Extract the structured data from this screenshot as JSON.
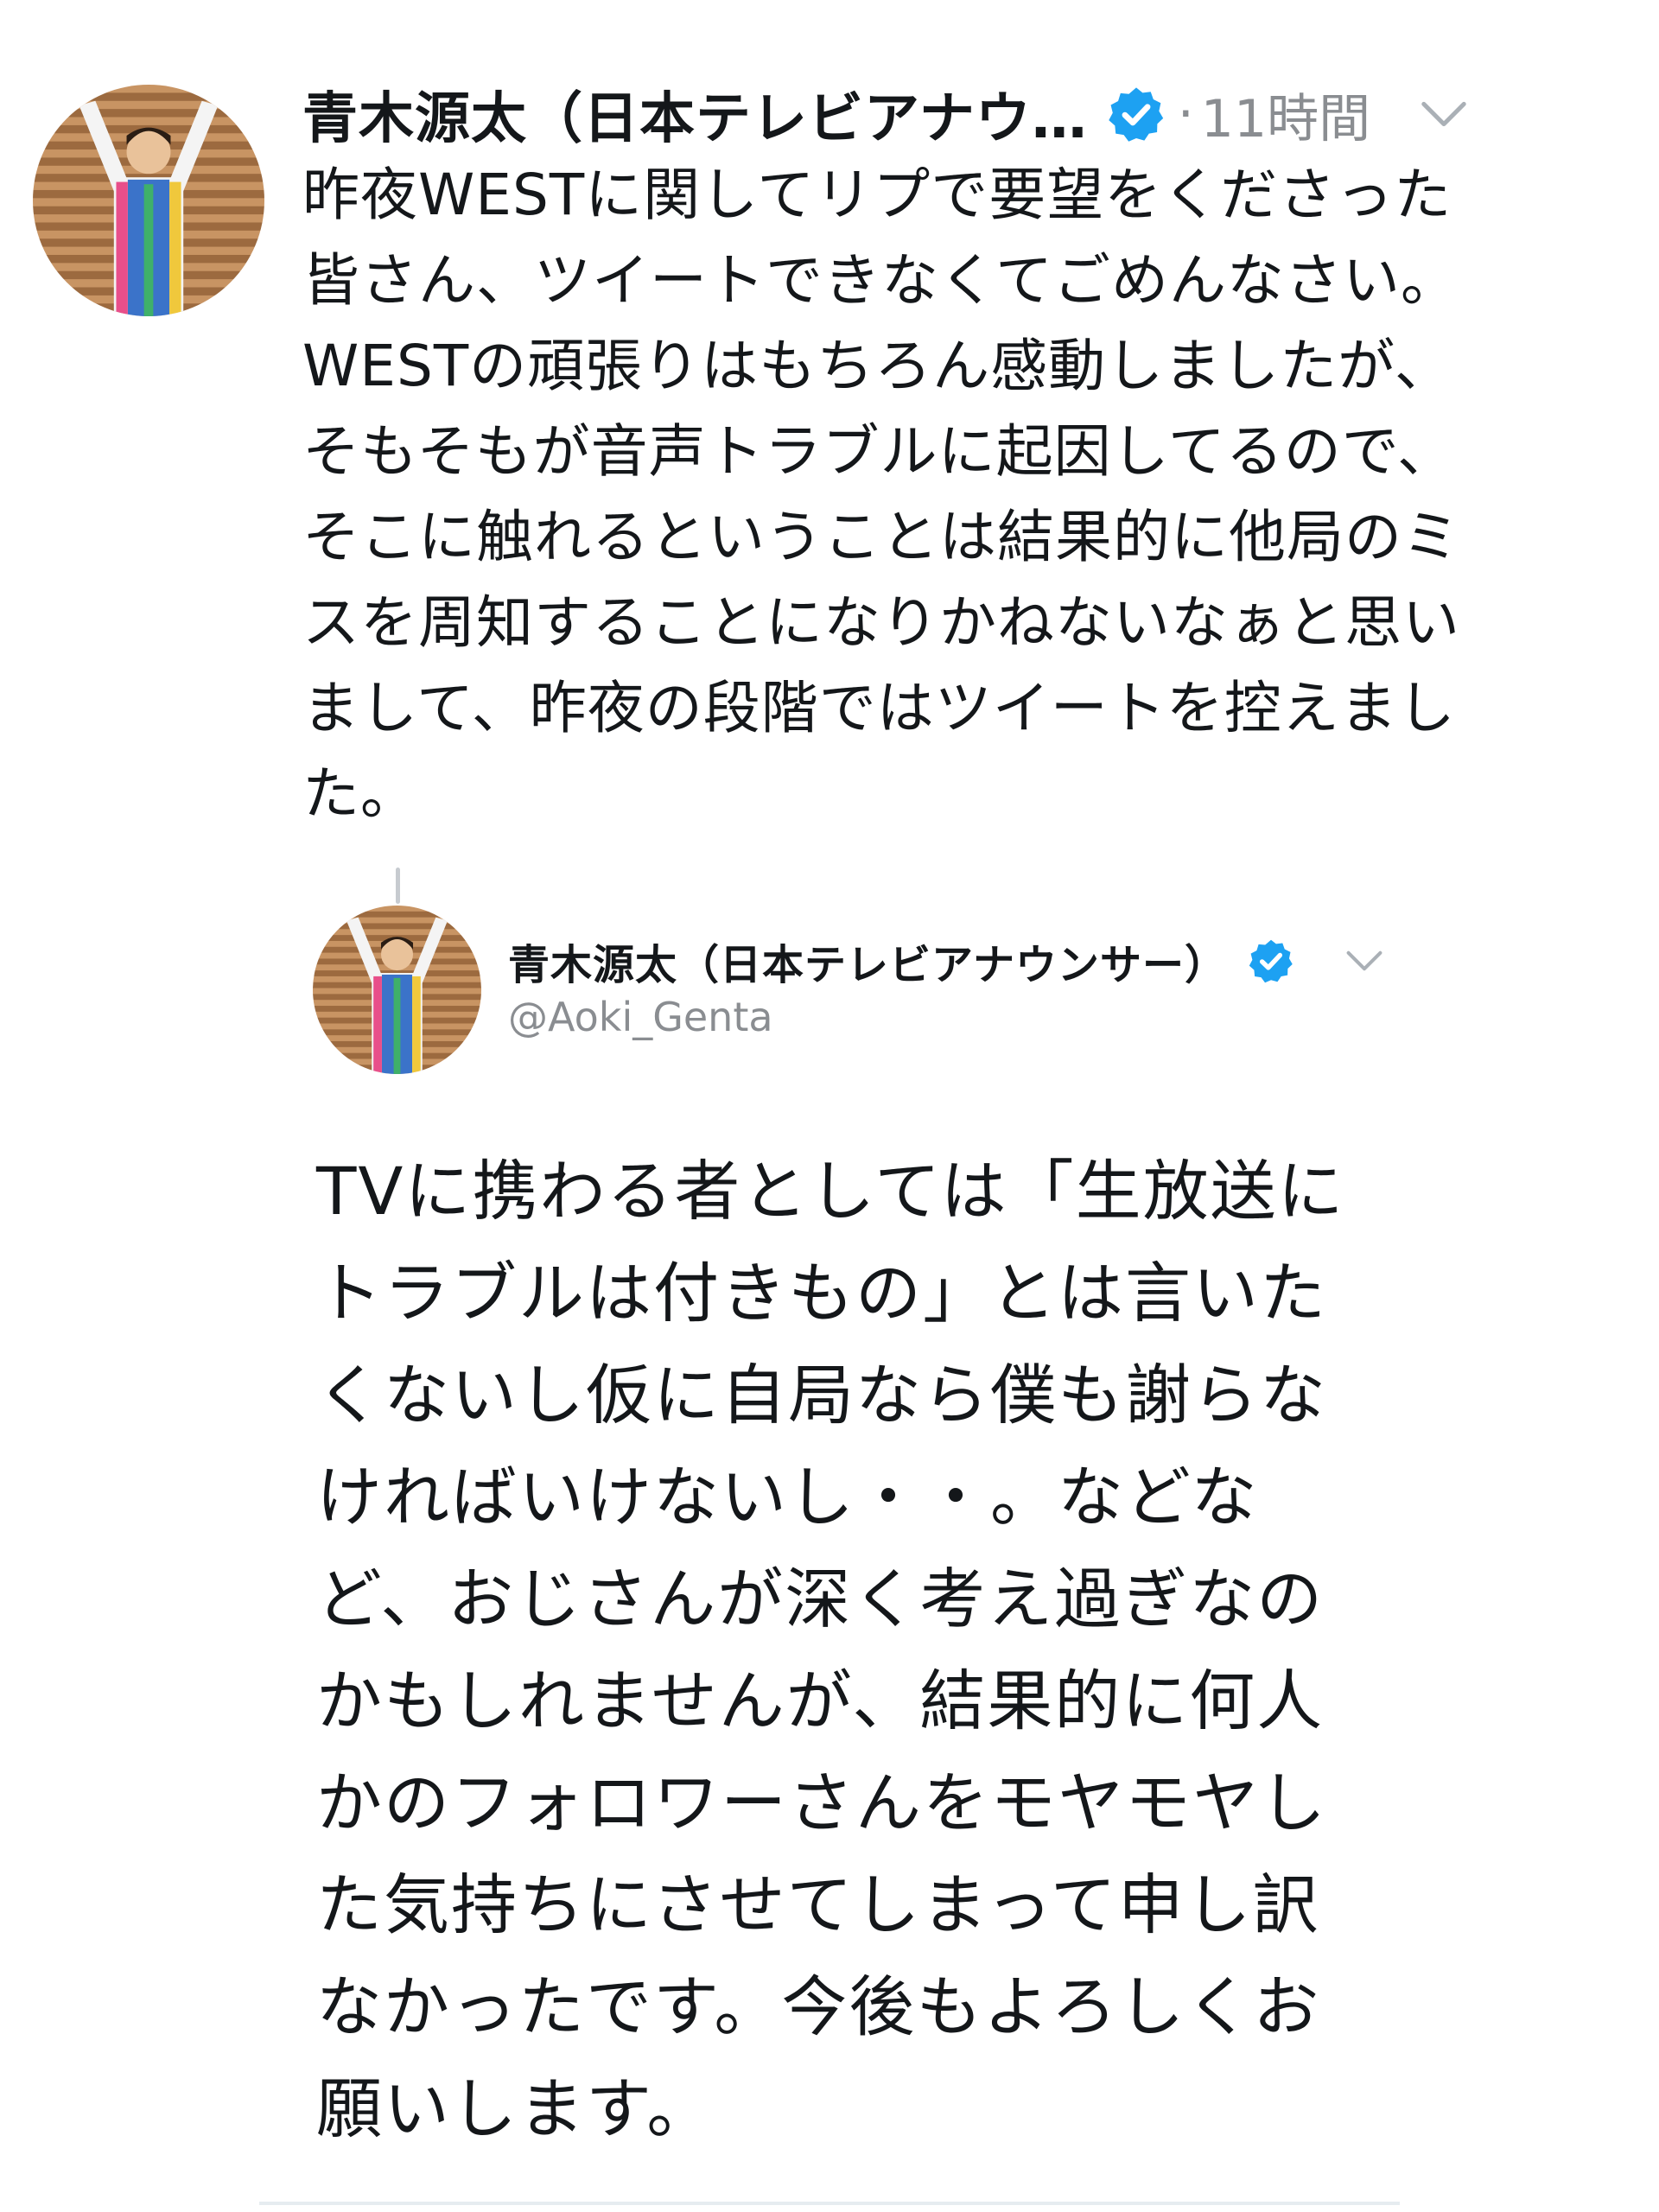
{
  "tweet": {
    "author_name": "青木源太（日本テレビアナウ…",
    "verified_icon": "verified-badge-icon",
    "separator": "·",
    "timestamp": "11時間",
    "menu_icon": "chevron-down-icon",
    "text_lines": [
      "昨夜WESTに関してリプで要望をくださった",
      "皆さん、ツイートできなくてごめんなさい。",
      "WESTの頑張りはもちろん感動しましたが、",
      "そもそもが音声トラブルに起因してるので、",
      "そこに触れるということは結果的に他局のミ",
      "スを周知することになりかねないなぁと思い",
      "まして、昨夜の段階ではツイートを控えまし",
      "た。"
    ]
  },
  "quoted_tweet": {
    "author_name": "青木源太（日本テレビアナウンサー）",
    "handle": "@Aoki_Genta",
    "verified_icon": "verified-badge-icon",
    "menu_icon": "chevron-down-icon",
    "text_lines": [
      "TVに携わる者としては「生放送に",
      "トラブルは付きもの」とは言いた",
      "くないし仮に自局なら僕も謝らな",
      "ければいけないし・・。などな",
      "ど、おじさんが深く考え過ぎなの",
      "かもしれませんが、結果的に何人",
      "かのフォロワーさんをモヤモヤし",
      "た気持ちにさせてしまって申し訳",
      "なかったです。今後もよろしくお",
      "願いします。"
    ]
  },
  "colors": {
    "text": "#14171a",
    "muted": "#8a8d91",
    "verified": "#1da1f2",
    "divider": "#e6ecf0"
  }
}
